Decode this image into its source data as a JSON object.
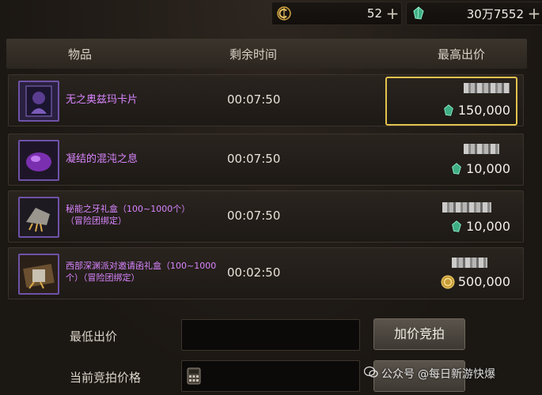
{
  "currency": {
    "gold_value": "52",
    "gem_value": "30万7552",
    "plus": "+"
  },
  "header": {
    "item": "物品",
    "remaining_time": "剩余时间",
    "highest_bid": "最高出价"
  },
  "rows": [
    {
      "name": "无之奥兹玛卡片",
      "time": "00:07:50",
      "price": "150,000",
      "currency": "gem"
    },
    {
      "name": "凝结的混沌之息",
      "time": "00:07:50",
      "price": "10,000",
      "currency": "gem"
    },
    {
      "name_line1": "秘能之牙礼盒（100~1000个）",
      "name_line2": "（冒险团绑定）",
      "time": "00:07:50",
      "price": "10,000",
      "currency": "gem"
    },
    {
      "name_line1": "西部深渊派对邀请函礼盒（100~1000",
      "name_line2": "个）（冒险团绑定）",
      "time": "00:02:50",
      "price": "500,000",
      "currency": "gold"
    }
  ],
  "form": {
    "min_bid_label": "最低出价",
    "current_bid_label": "当前竞拍价格",
    "raise_bid_button": "加价竞拍"
  },
  "watermark": {
    "text": "@每日新游快爆",
    "partial_text": "公众号"
  },
  "colors": {
    "item_name": "#d985ff",
    "selection_border": "#e2c34d",
    "gem": "#4fc89a",
    "gold": "#d4a640"
  }
}
